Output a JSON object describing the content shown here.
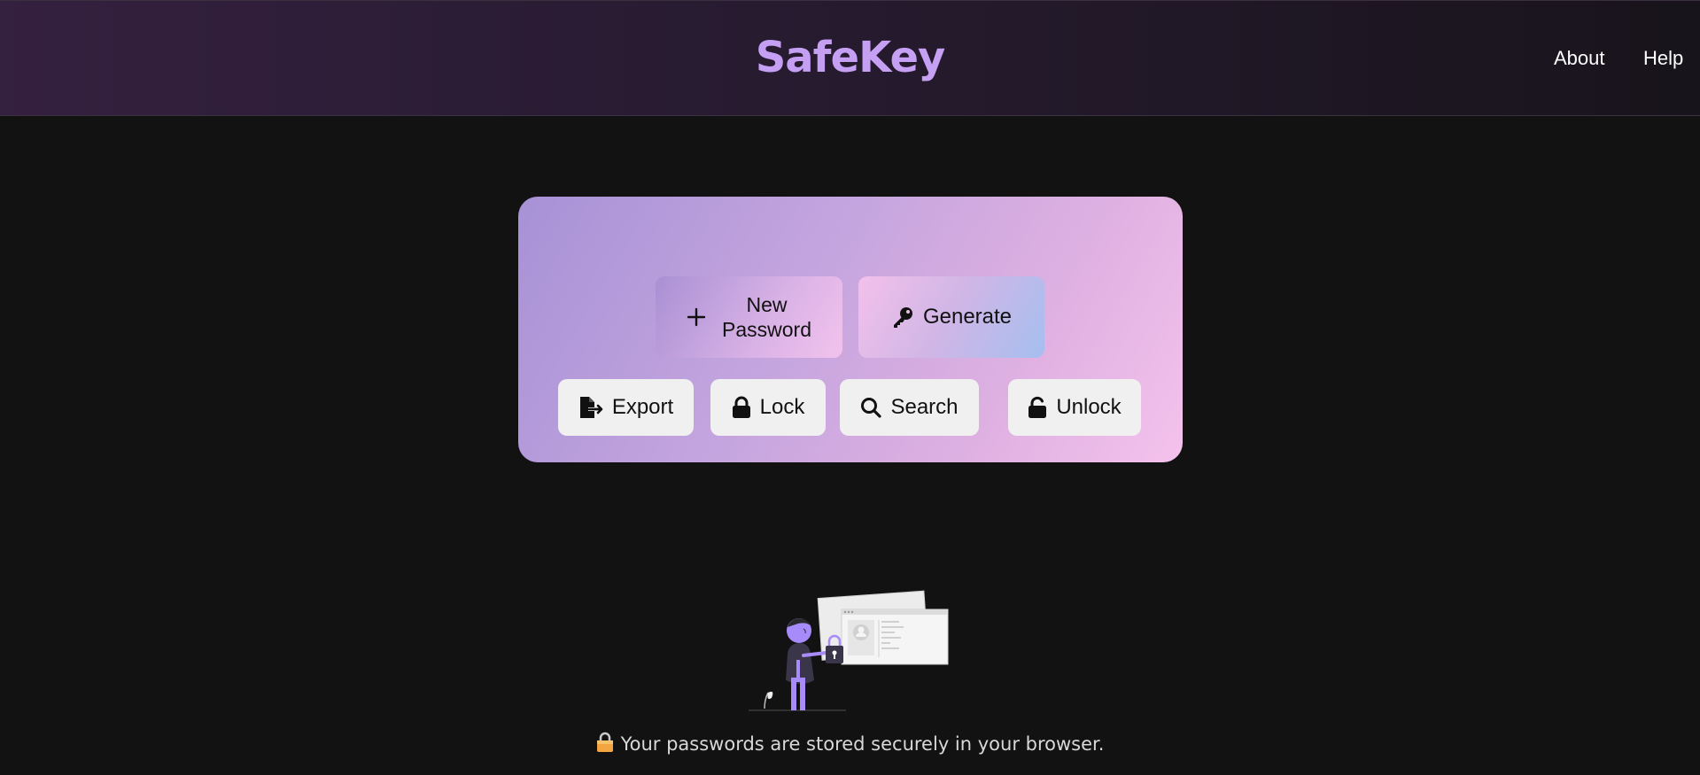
{
  "header": {
    "brand": "SafeKey",
    "nav": [
      {
        "label": "About"
      },
      {
        "label": "Help"
      }
    ]
  },
  "actions": {
    "new_password": {
      "line1": "New",
      "line2": "Password",
      "icon": "plus-icon"
    },
    "generate": {
      "label": "Generate",
      "icon": "key-icon"
    },
    "export": {
      "label": "Export",
      "icon": "file-export-icon"
    },
    "lock": {
      "label": "Lock",
      "icon": "lock-icon"
    },
    "search": {
      "label": "Search",
      "icon": "search-icon"
    },
    "unlock": {
      "label": "Unlock",
      "icon": "unlock-icon"
    }
  },
  "footer": {
    "note": "Your passwords are stored securely in your browser.",
    "icon": "lock-emoji-icon"
  },
  "colors": {
    "background": "#121212",
    "brand_accent": "#c7a0f3",
    "panel_gradient_start": "#a792d6",
    "panel_gradient_end": "#f4c2ec",
    "illustration_accent": "#a78bfa"
  }
}
